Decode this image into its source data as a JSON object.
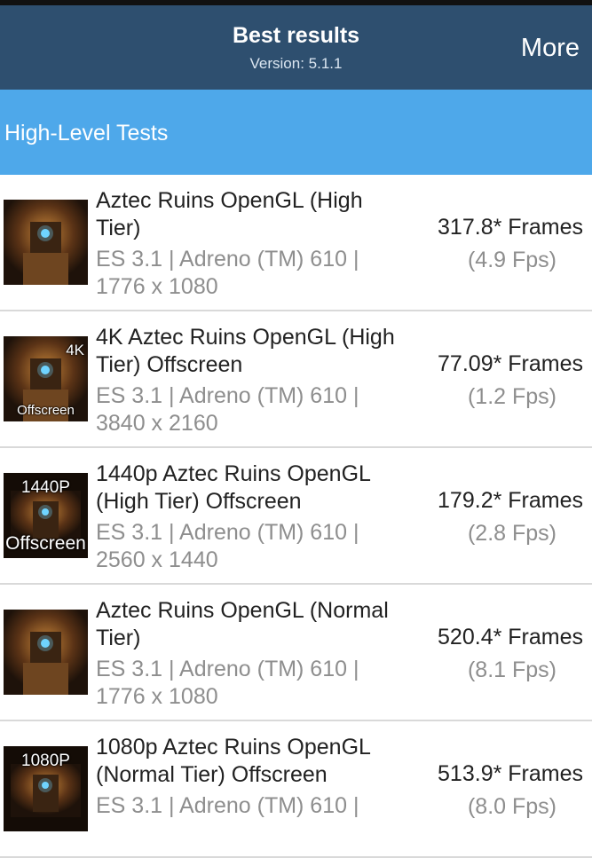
{
  "appbar": {
    "title": "Best results",
    "subtitle": "Version: 5.1.1",
    "more_label": "More"
  },
  "section": {
    "title": "High-Level Tests"
  },
  "results": [
    {
      "name": "Aztec Ruins OpenGL (High Tier)",
      "detail_line1": "ES 3.1 | Adreno (TM) 610 |",
      "detail_line2": "1776 x 1080",
      "frames": "317.8* Frames",
      "fps": "(4.9 Fps)",
      "thumb_top": "",
      "thumb_bottom": ""
    },
    {
      "name": "4K Aztec Ruins OpenGL (High Tier) Offscreen",
      "detail_line1": "ES 3.1 | Adreno (TM) 610 |",
      "detail_line2": "3840 x 2160",
      "frames": "77.09* Frames",
      "fps": "(1.2 Fps)",
      "thumb_top": "4K",
      "thumb_bottom": "Offscreen"
    },
    {
      "name": "1440p Aztec Ruins OpenGL (High Tier) Offscreen",
      "detail_line1": "ES 3.1 | Adreno (TM) 610 |",
      "detail_line2": "2560 x 1440",
      "frames": "179.2* Frames",
      "fps": "(2.8 Fps)",
      "thumb_top": "1440P",
      "thumb_bottom": "Offscreen"
    },
    {
      "name": "Aztec Ruins OpenGL (Normal Tier)",
      "detail_line1": "ES 3.1 | Adreno (TM) 610 |",
      "detail_line2": "1776 x 1080",
      "frames": "520.4* Frames",
      "fps": "(8.1 Fps)",
      "thumb_top": "",
      "thumb_bottom": ""
    },
    {
      "name": "1080p Aztec Ruins OpenGL (Normal Tier) Offscreen",
      "detail_line1": "ES 3.1 | Adreno (TM) 610 |",
      "detail_line2": "",
      "frames": "513.9* Frames",
      "fps": "(8.0 Fps)",
      "thumb_top": "1080P",
      "thumb_bottom": ""
    }
  ]
}
